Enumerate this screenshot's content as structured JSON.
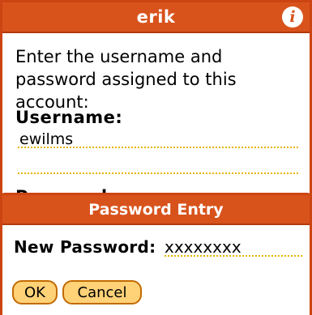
{
  "window": {
    "title": "erik"
  },
  "prompt": "Enter the username and password assigned to this account:",
  "username": {
    "label": "Username:",
    "value": "ewilms"
  },
  "password_label_partial": "Password:",
  "dialog": {
    "title": "Password Entry",
    "new_password_label": "New Password:",
    "new_password_value": "xxxxxxxx",
    "ok_label": "OK",
    "cancel_label": "Cancel"
  },
  "colors": {
    "accent": "#d8531c",
    "border": "#cc4411",
    "button_fill": "#ffd278",
    "dotted_line": "#e8b400"
  },
  "icons": {
    "info": "info-icon"
  }
}
